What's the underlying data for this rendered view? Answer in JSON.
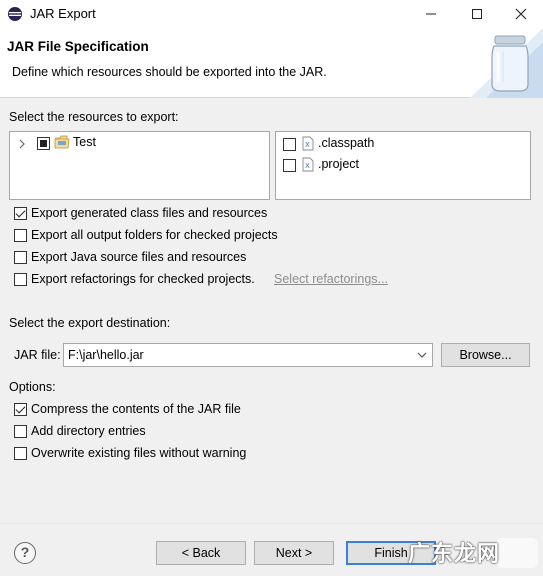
{
  "window": {
    "title": "JAR Export"
  },
  "header": {
    "title": "JAR File Specification",
    "description": "Define which resources should be exported into the JAR."
  },
  "resources": {
    "label": "Select the resources to export:",
    "tree": [
      {
        "label": "Test",
        "state": "partial",
        "expanded": false
      }
    ],
    "files": [
      {
        "label": ".classpath",
        "checked": false
      },
      {
        "label": ".project",
        "checked": false
      }
    ]
  },
  "export_options": [
    {
      "label": "Export generated class files and resources",
      "checked": true
    },
    {
      "label": "Export all output folders for checked projects",
      "checked": false
    },
    {
      "label": "Export Java source files and resources",
      "checked": false
    },
    {
      "label": "Export refactorings for checked projects.",
      "checked": false,
      "link": "Select refactorings..."
    }
  ],
  "destination": {
    "label": "Select the export destination:",
    "jar_file_label": "JAR file:",
    "jar_file_value": "F:\\jar\\hello.jar",
    "browse_label": "Browse..."
  },
  "options": {
    "label": "Options:",
    "items": [
      {
        "label": "Compress the contents of the JAR file",
        "checked": true
      },
      {
        "label": "Add directory entries",
        "checked": false
      },
      {
        "label": "Overwrite existing files without warning",
        "checked": false
      }
    ]
  },
  "footer": {
    "help": "?",
    "back_label": "< Back",
    "next_label": "Next >",
    "finish_label": "Finish",
    "watermark": "广东龙网"
  }
}
